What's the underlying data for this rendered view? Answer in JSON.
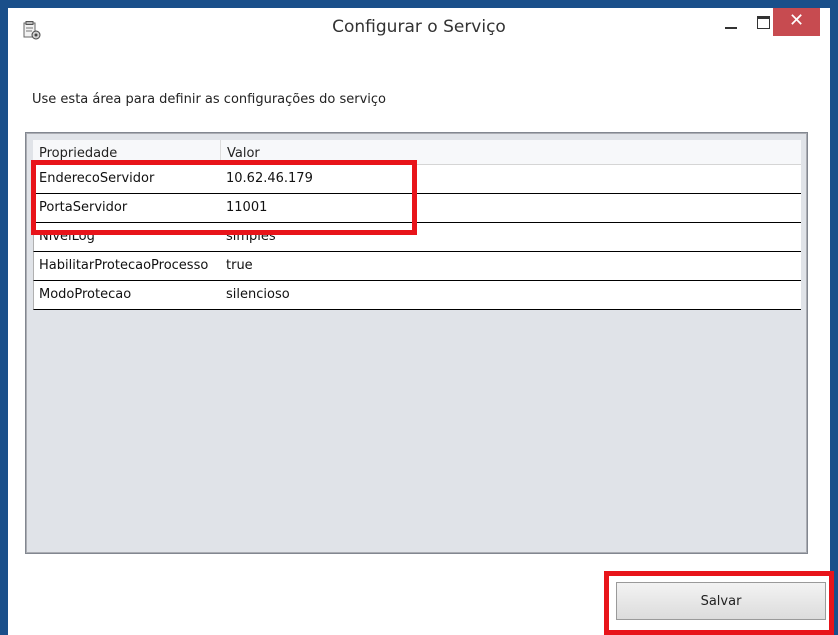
{
  "window": {
    "title": "Configurar o Serviço",
    "minimize_label": "–",
    "close_label": "✕"
  },
  "instructions": "Use esta área para definir as configurações do serviço",
  "grid": {
    "headers": [
      "Propriedade",
      "Valor"
    ],
    "rows": [
      {
        "key": "EnderecoServidor",
        "value": "10.62.46.179"
      },
      {
        "key": "PortaServidor",
        "value": "11001"
      },
      {
        "key": "NivelLog",
        "value": "simples"
      },
      {
        "key": "HabilitarProtecaoProcesso",
        "value": "true"
      },
      {
        "key": "ModoProtecao",
        "value": "silencioso"
      }
    ]
  },
  "actions": {
    "save_label": "Salvar"
  },
  "colors": {
    "highlight": "#e8141a",
    "window_border": "#1a4f8a",
    "close_button": "#c74b50"
  },
  "icons": {
    "app": "settings-document-icon",
    "minimize": "minimize-icon",
    "maximize": "maximize-icon",
    "close": "close-icon"
  }
}
